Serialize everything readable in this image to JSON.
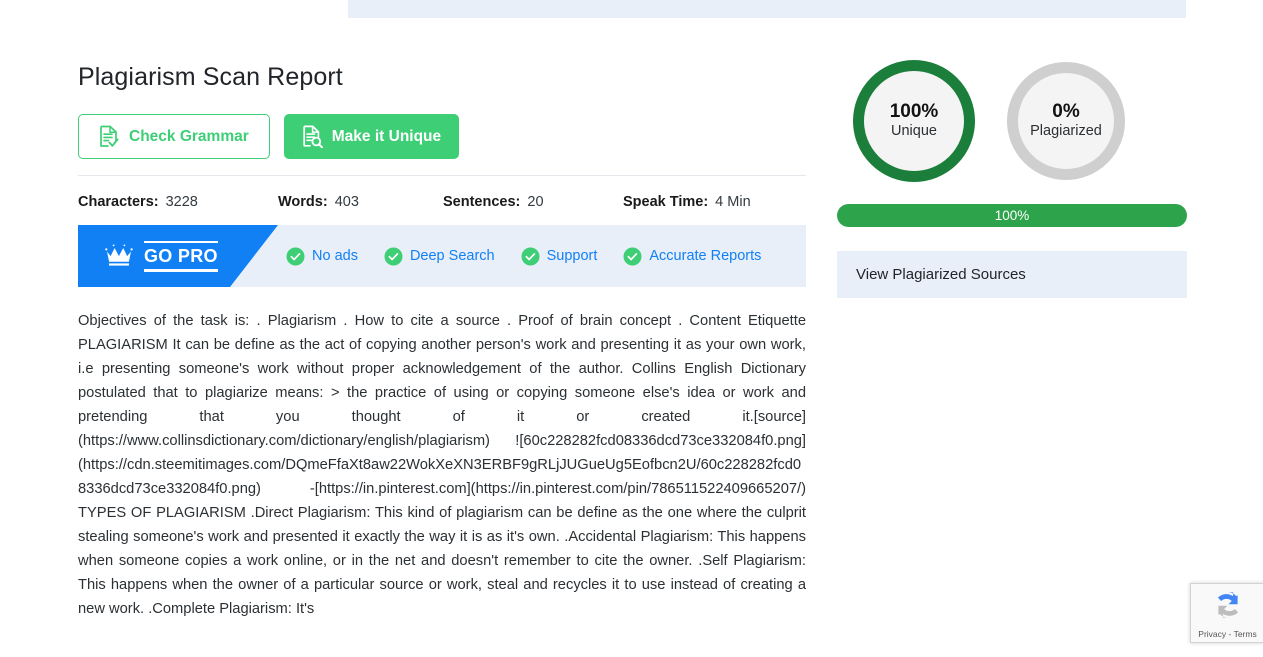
{
  "page": {
    "title": "Plagiarism Scan Report"
  },
  "actions": {
    "check_grammar": {
      "label": "Check Grammar",
      "icon": "document-check-icon"
    },
    "make_unique": {
      "label": "Make it Unique",
      "icon": "document-search-icon"
    }
  },
  "stats": [
    {
      "label": "Characters:",
      "value": "3228"
    },
    {
      "label": "Words:",
      "value": "403"
    },
    {
      "label": "Sentences:",
      "value": "20"
    },
    {
      "label": "Speak Time:",
      "value": "4 Min"
    }
  ],
  "gopro": {
    "badge_label": "GO PRO",
    "crown_icon": "crown-icon",
    "accent_color": "#1180f5",
    "background_color": "#e9eff8",
    "perks": [
      {
        "label": "No ads",
        "icon": "check-circle-icon"
      },
      {
        "label": "Deep Search",
        "icon": "check-circle-icon"
      },
      {
        "label": "Support",
        "icon": "check-circle-icon"
      },
      {
        "label": "Accurate Reports",
        "icon": "check-circle-icon"
      }
    ]
  },
  "results": {
    "unique": {
      "percent": "100%",
      "label": "Unique",
      "ring_color": "#1b7f3b"
    },
    "plagiarized": {
      "percent": "0%",
      "label": "Plagiarized",
      "ring_color": "#cfcfcf"
    },
    "progress": {
      "value": "100%",
      "bar_color": "#2da34c"
    },
    "sources_button": "View Plagiarized Sources"
  },
  "article": {
    "body": "Objectives of the task is: . Plagiarism . How to cite a source . Proof of brain concept . Content Etiquette PLAGIARISM It can be define as the act of copying another person's work and presenting it as your own work, i.e presenting someone's work without proper acknowledgement of the author. Collins English Dictionary postulated that to plagiarize means: > the practice of using or copying someone else's idea or work and pretending that you thought of it or created it.[source](https://www.collinsdictionary.com/dictionary/english/plagiarism) ![60c228282fcd08336dcd73ce332084f0.png](https://cdn.steemitimages.com/DQmeFfaXt8aw22WokXeXN3ERBF9gRLjJUGueUg5Eofbcn2U/60c228282fcd08336dcd73ce332084f0.png)          -[https://in.pinterest.com](https://in.pinterest.com/pin/786511522409665207/) TYPES OF PLAGIARISM .Direct Plagiarism: This kind of plagiarism can be define as the one where the culprit stealing someone's work and presented it exactly the way it is as it's own. .Accidental Plagiarism: This happens when someone copies a work online, or in the net and doesn't remember to cite the owner. .Self Plagiarism: This happens when the owner of a particular source or work, steal and recycles it to use instead of creating a new work. .Complete Plagiarism: It's"
  },
  "recaptcha": {
    "icon": "recaptcha-icon",
    "terms": "Privacy - Terms"
  }
}
